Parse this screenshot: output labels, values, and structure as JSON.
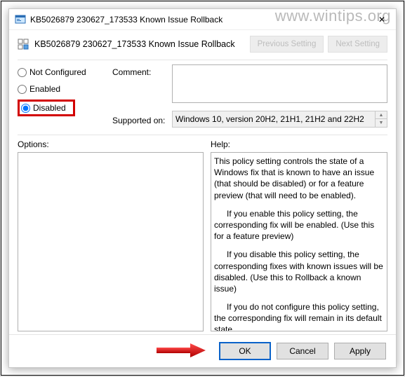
{
  "watermark": "www.wintips.org",
  "window": {
    "title": "KB5026879 230627_173533 Known Issue Rollback",
    "subtitle": "KB5026879 230627_173533 Known Issue Rollback",
    "close_glyph": "✕"
  },
  "nav": {
    "previous": "Previous Setting",
    "next": "Next Setting"
  },
  "radios": {
    "not_configured": "Not Configured",
    "enabled": "Enabled",
    "disabled": "Disabled",
    "selected": "disabled"
  },
  "fields": {
    "comment_label": "Comment:",
    "comment_value": "",
    "supported_label": "Supported on:",
    "supported_value": "Windows 10, version 20H2, 21H1, 21H2 and 22H2"
  },
  "sections": {
    "options_label": "Options:",
    "help_label": "Help:"
  },
  "help": {
    "p1": "This policy setting controls the state of a Windows fix that is known to have an issue (that should be disabled) or for a feature preview (that will need to be enabled).",
    "p2": "If you enable this policy setting, the corresponding fix will be enabled. (Use this for a feature preview)",
    "p3": "If you disable this policy setting, the corresponding fixes with known issues will be disabled. (Use this to Rollback a known issue)",
    "p4": "If you do not configure this policy setting, the corresponding fix will remain in its default state."
  },
  "buttons": {
    "ok": "OK",
    "cancel": "Cancel",
    "apply": "Apply"
  },
  "icons": {
    "title_icon": "gp-icon",
    "close": "close-icon"
  },
  "colors": {
    "highlight": "#d20000",
    "primary_border": "#0a62c9"
  }
}
